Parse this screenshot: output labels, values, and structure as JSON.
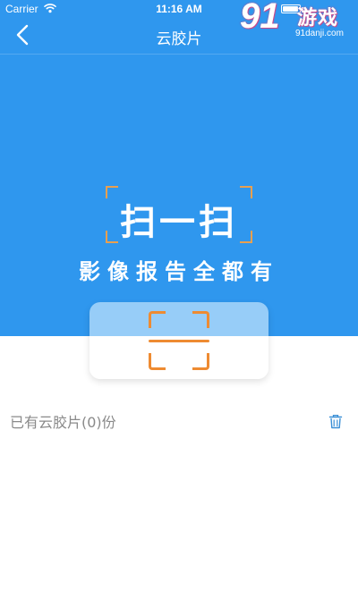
{
  "status_bar": {
    "carrier": "Carrier",
    "time": "11:16 AM",
    "wifi_icon": "wifi-icon",
    "battery_icon": "battery-icon"
  },
  "watermark": {
    "logo": "91",
    "game_text": "游戏",
    "url": "91danji.com"
  },
  "nav": {
    "title": "云胶片",
    "back_icon": "chevron-left-icon"
  },
  "hero": {
    "title": "扫一扫",
    "subtitle": "影像报告全都有"
  },
  "scan_card": {
    "icon": "scan-icon"
  },
  "films": {
    "label": "已有云胶片(0)份",
    "delete_icon": "trash-icon"
  },
  "colors": {
    "primary_blue": "#2f97ee",
    "card_top": "#97cdf8",
    "scan_orange": "#ee8b32",
    "hero_bracket": "#e8a050",
    "label_gray": "#8a8a8a",
    "icon_blue": "#3a8fd6"
  }
}
